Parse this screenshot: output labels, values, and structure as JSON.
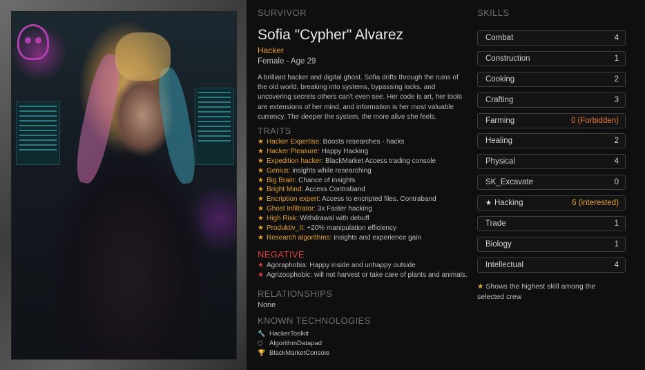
{
  "headers": {
    "survivor": "SURVIVOR",
    "skills": "SKILLS",
    "traits": "TRAITS",
    "negative": "NEGATIVE",
    "relationships": "RELATIONSHIPS",
    "technologies": "KNOWN TECHNOLOGIES"
  },
  "survivor": {
    "name": "Sofia \"Cypher\" Alvarez",
    "role": "Hacker",
    "meta": "Female - Age 29",
    "bio": "A brilliant hacker and digital ghost. Sofia drifts through the ruins of the old world, breaking into systems, bypassing locks, and uncovering secrets others can't even see. Her code is art, her tools are extensions of her mind, and information is her most valuable currency. The deeper the system, the more alive she feels."
  },
  "traits": [
    {
      "name": "Hacker Expertise:",
      "desc": "Boosts researches - hacks"
    },
    {
      "name": "Hacker Pleasure:",
      "desc": "Happy Hacking"
    },
    {
      "name": "Expedition hacker:",
      "desc": "BlackMarket Access trading console"
    },
    {
      "name": "Genius:",
      "desc": "insights while researching"
    },
    {
      "name": "Big Brain:",
      "desc": "Chance of insights"
    },
    {
      "name": "Bright Mind:",
      "desc": "Access Contraband"
    },
    {
      "name": "Encription expert:",
      "desc": "Access to encripted files. Contraband"
    },
    {
      "name": "Ghost Infiltrator:",
      "desc": "3x Faster hacking"
    },
    {
      "name": "High Risk:",
      "desc": "Withdrawal with debuff"
    },
    {
      "name": "Produktiv_II:",
      "desc": "+20% manipulation efficiency"
    },
    {
      "name": "Research algorithms:",
      "desc": "insights and experience gain"
    }
  ],
  "negative": [
    {
      "text": "Agoraphobia: Happy inside and unhappy outside"
    },
    {
      "text": "Agrizoophobic: will not harvest or take care of plants and animals."
    }
  ],
  "relationships": "None",
  "technologies": [
    {
      "icon": "wrench-icon",
      "glyph": "🔧",
      "label": "HackerToolkit"
    },
    {
      "icon": "chip-icon",
      "glyph": "⬡",
      "label": "AlgorithmDatapad"
    },
    {
      "icon": "trophy-icon",
      "glyph": "🏆",
      "label": "BlackMarketConsole"
    }
  ],
  "skills": [
    {
      "label": "Combat",
      "value": "4",
      "star": false,
      "style": ""
    },
    {
      "label": "Construction",
      "value": "1",
      "star": false,
      "style": ""
    },
    {
      "label": "Cooking",
      "value": "2",
      "star": false,
      "style": ""
    },
    {
      "label": "Crafting",
      "value": "3",
      "star": false,
      "style": ""
    },
    {
      "label": "Farming",
      "value": "0 (Forbidden)",
      "star": false,
      "style": "hl"
    },
    {
      "label": "Healing",
      "value": "2",
      "star": false,
      "style": ""
    },
    {
      "label": "Physical",
      "value": "4",
      "star": false,
      "style": ""
    },
    {
      "label": "SK_Excavate",
      "value": "0",
      "star": false,
      "style": ""
    },
    {
      "label": "Hacking",
      "value": "6 (interested)",
      "star": true,
      "style": "gold"
    },
    {
      "label": "Trade",
      "value": "1",
      "star": false,
      "style": ""
    },
    {
      "label": "Biology",
      "value": "1",
      "star": false,
      "style": ""
    },
    {
      "label": "Intellectual",
      "value": "4",
      "star": false,
      "style": ""
    }
  ],
  "legend": "Shows the highest skill among the selected crew",
  "colors": {
    "accent": "#e2a033",
    "negative": "#d94040",
    "forbidden": "#e27a33"
  }
}
